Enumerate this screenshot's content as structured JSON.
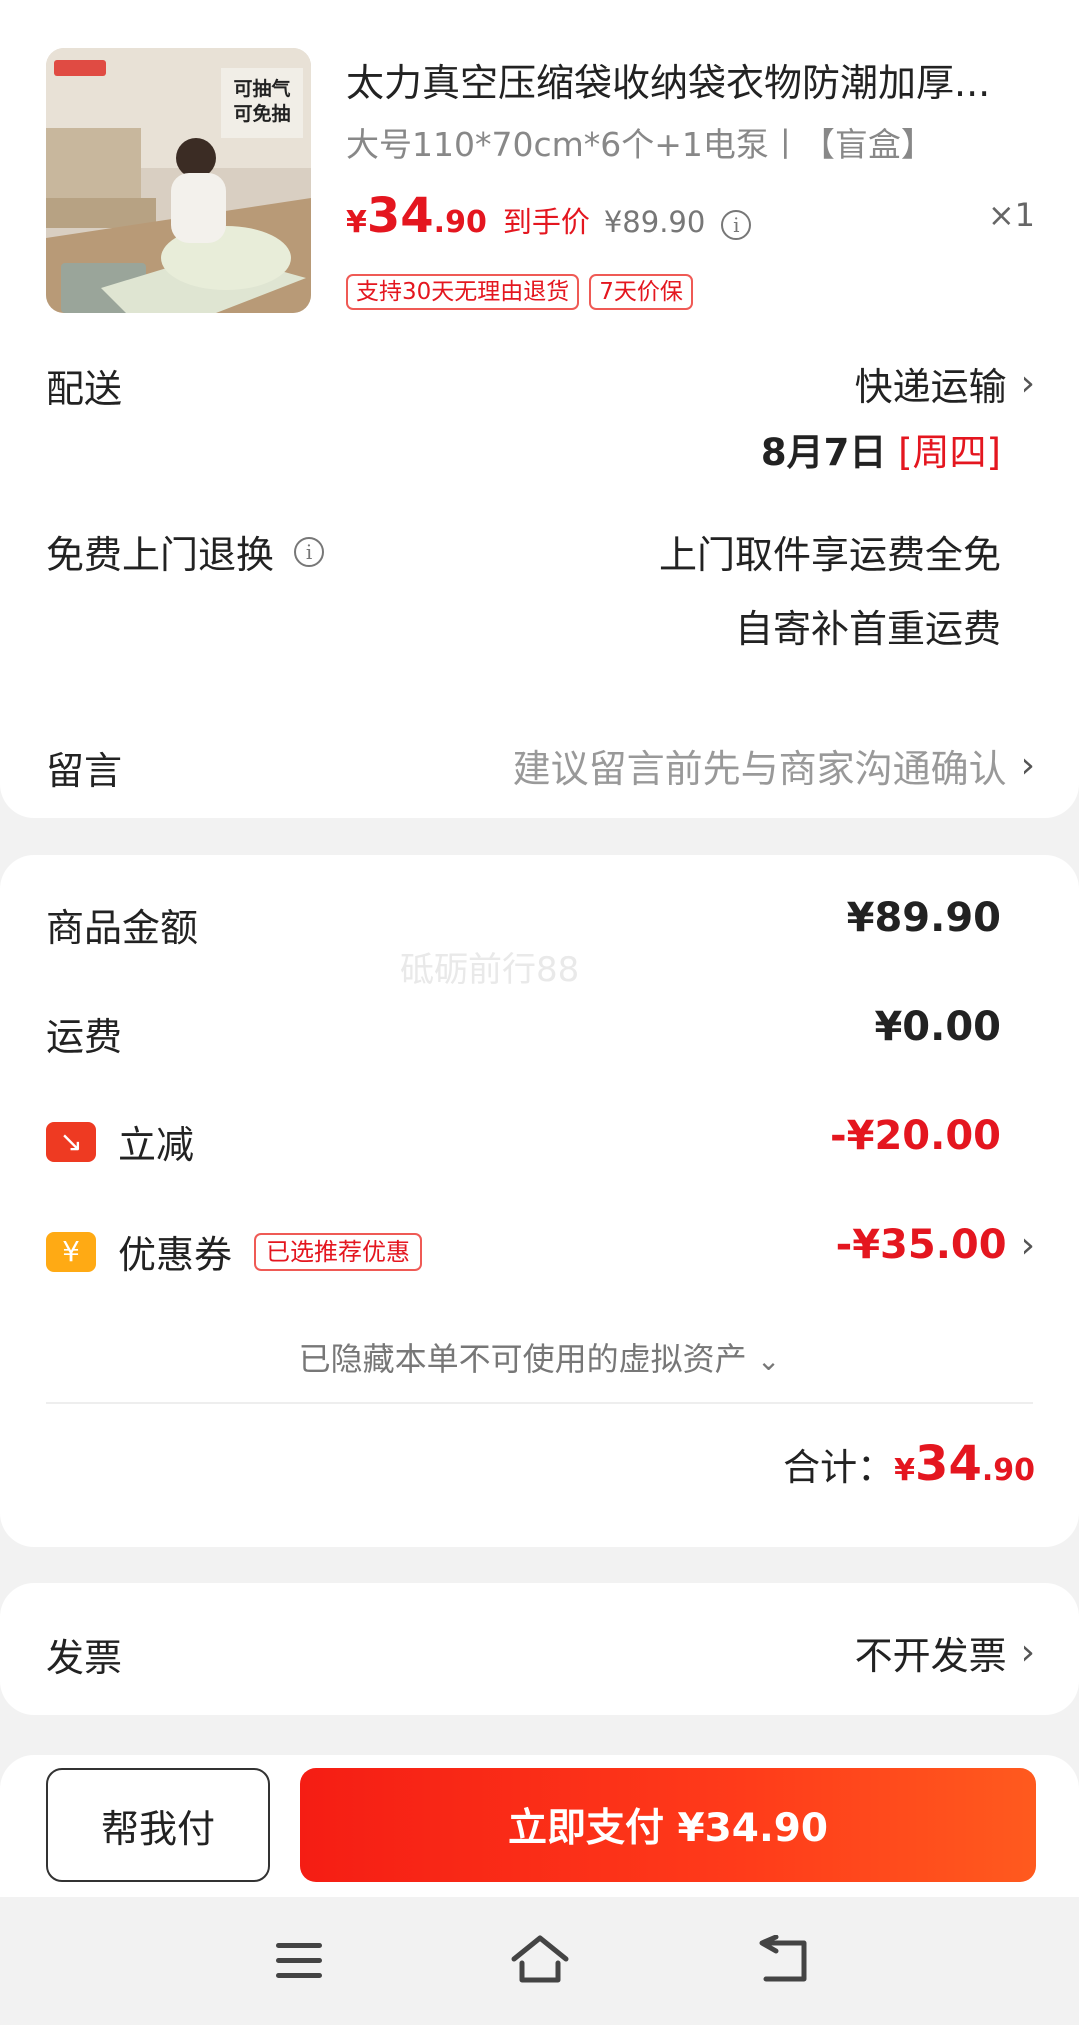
{
  "product": {
    "title": "太力真空压缩袋收纳袋衣物防潮加厚...",
    "spec": "大号110*70cm*6个+1电泵丨【盲盒】",
    "price_symbol": "¥",
    "price_int": "34",
    "price_dec": ".90",
    "price_label": "到手价",
    "original_price": "¥89.90",
    "quantity": "×1",
    "thumb_text": [
      "可抽气",
      "可免抽"
    ],
    "tags": [
      "支持30天无理由退货",
      "7天价保"
    ]
  },
  "delivery": {
    "label": "配送",
    "method": "快递运输",
    "date": "8月7日",
    "weekday": "[周四]"
  },
  "returns": {
    "label": "免费上门退换",
    "line1": "上门取件享运费全免",
    "line2": "自寄补首重运费"
  },
  "message": {
    "label": "留言",
    "placeholder": "建议留言前先与商家沟通确认"
  },
  "pricing": {
    "goods_label": "商品金额",
    "goods_value": "¥89.90",
    "shipping_label": "运费",
    "shipping_value": "¥0.00",
    "discount_label": "立减",
    "discount_value": "-¥20.00",
    "coupon_label": "优惠券",
    "coupon_tag": "已选推荐优惠",
    "coupon_value": "-¥35.00",
    "hidden_assets": "已隐藏本单不可使用的虚拟资产",
    "total_label": "合计：",
    "total_symbol": "¥",
    "total_int": "34",
    "total_dec": ".90",
    "watermark": "砥砺前行88"
  },
  "invoice": {
    "label": "发票",
    "value": "不开发票"
  },
  "actions": {
    "help_pay": "帮我付",
    "pay_now": "立即支付 ¥34.90"
  },
  "colors": {
    "accent": "#e4161f",
    "pay_button": "#f51d14"
  }
}
